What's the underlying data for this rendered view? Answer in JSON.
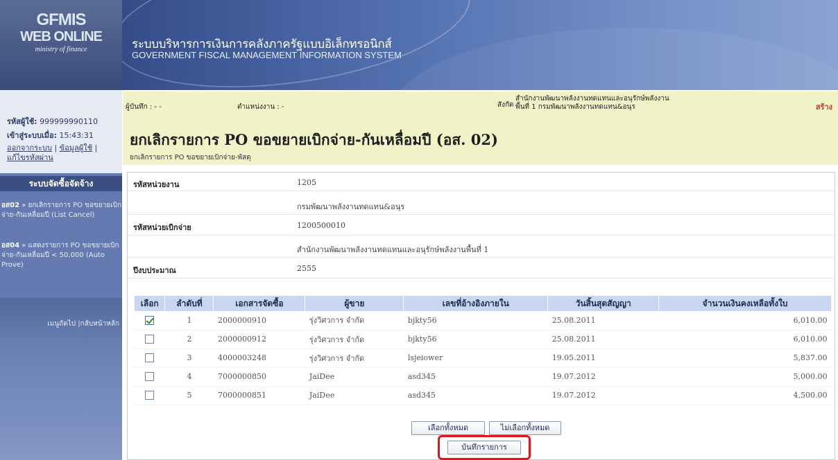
{
  "banner": {
    "logo_main": "GFMIS",
    "logo_sub": "WEB ONLINE",
    "logo_tagline": "ministry of finance",
    "title_th": "ระบบบริหารการเงินการคลังภาครัฐแบบอิเล็กทรอนิกส์",
    "title_en": "GOVERNMENT FISCAL MANAGEMENT INFORMATION SYSTEM"
  },
  "user": {
    "user_id_label": "รหัสผู้ใช้:",
    "user_id": "999999990110",
    "login_label": "เข้าสู่ระบบเมื่อ:",
    "login_time": "15:43:31",
    "logout": "ออกจากระบบ",
    "profile": "ข้อมูลผู้ใช้",
    "change_password": "แก้ไขรหัสผ่าน"
  },
  "menu": {
    "header": "ระบบจัดซื้อจัดจ้าง",
    "items": [
      {
        "code": "อส02",
        "text": "ยกเลิกรายการ PO ขอขยายเบิกจ่าย-กันเหลื่อมปี (List Cancel)"
      },
      {
        "code": "อส04",
        "text": "แสดงรายการ PO ขอขยายเบิกจ่าย-กันเหลื่อมปี < 50,000 (Auto Prove)"
      }
    ],
    "next_menu": "เมนูถัดไป",
    "home": "กลับหน้าหลัก"
  },
  "header": {
    "recorder_label": "ผู้บันทึก : - -",
    "position_label": "ตำแหน่งงาน : -",
    "org_label": "สังกัด :",
    "org_line1": "สำนักงานพัฒนาพลังงานทดแทนและอนุรักษ์พลังงาน",
    "org_line2": "พื้นที่ 1 กรมพัฒนาพลังงานทดแทน&อนุร",
    "create": "สร้าง",
    "title": "ยกเลิกรายการ PO ขอขยายเบิกจ่าย-กันเหลื่อมปี (อส. 02)",
    "subtitle": "ยกเลิกรายการ PO ขอขยายเบิกจ่าย-พัสดุ"
  },
  "form": {
    "agency_code_label": "รหัสหน่วยงาน",
    "agency_code": "1205",
    "agency_name": "กรมพัฒนาพลังงานทดแทน&อนุร",
    "disb_unit_label": "รหัสหน่วยเบิกจ่าย",
    "disb_unit_code": "1200500010",
    "disb_unit_name": "สำนักงานพัฒนาพลังงานทดแทนและอนุรักษ์พลังงานพื้นที่ 1",
    "fiscal_year_label": "ปีงบประมาณ",
    "fiscal_year": "2555"
  },
  "table": {
    "headers": [
      "เลือก",
      "ลำดับที่",
      "เอกสารจัดซื้อ",
      "ผู้ขาย",
      "เลขที่อ้างอิงภายใน",
      "วันสิ้นสุดสัญญา",
      "จำนวนเงินคงเหลือทั้งใบ"
    ],
    "rows": [
      {
        "checked": true,
        "seq": "1",
        "doc": "2000000910",
        "vendor": "รุ่งวิศวการ จำกัด",
        "ref": "bjkty56",
        "end_date": "25.08.2011",
        "amount": "6,010.00"
      },
      {
        "checked": false,
        "seq": "2",
        "doc": "2000000912",
        "vendor": "รุ่งวิศวการ จำกัด",
        "ref": "bjkty56",
        "end_date": "25.08.2011",
        "amount": "6,010.00"
      },
      {
        "checked": false,
        "seq": "3",
        "doc": "4000003248",
        "vendor": "รุ่งวิศวการ จำกัด",
        "ref": "lsjeiower",
        "end_date": "19.05.2011",
        "amount": "5,837.00"
      },
      {
        "checked": false,
        "seq": "4",
        "doc": "7000000850",
        "vendor": "JaiDee",
        "ref": "asd345",
        "end_date": "19.07.2012",
        "amount": "5,000.00"
      },
      {
        "checked": false,
        "seq": "5",
        "doc": "7000000851",
        "vendor": "JaiDee",
        "ref": "asd345",
        "end_date": "19.07.2012",
        "amount": "4,500.00"
      }
    ]
  },
  "buttons": {
    "select_all": "เลือกทั้งหมด",
    "deselect_all": "ไม่เลือกทั้งหมด",
    "save": "บันทึกรายการ"
  },
  "colors": {
    "banner": "#3b5492",
    "sidebar": "#647ab0",
    "header_bg": "#f0f3c8",
    "table_header": "#c9d6ef",
    "highlight": "#e3141a"
  }
}
